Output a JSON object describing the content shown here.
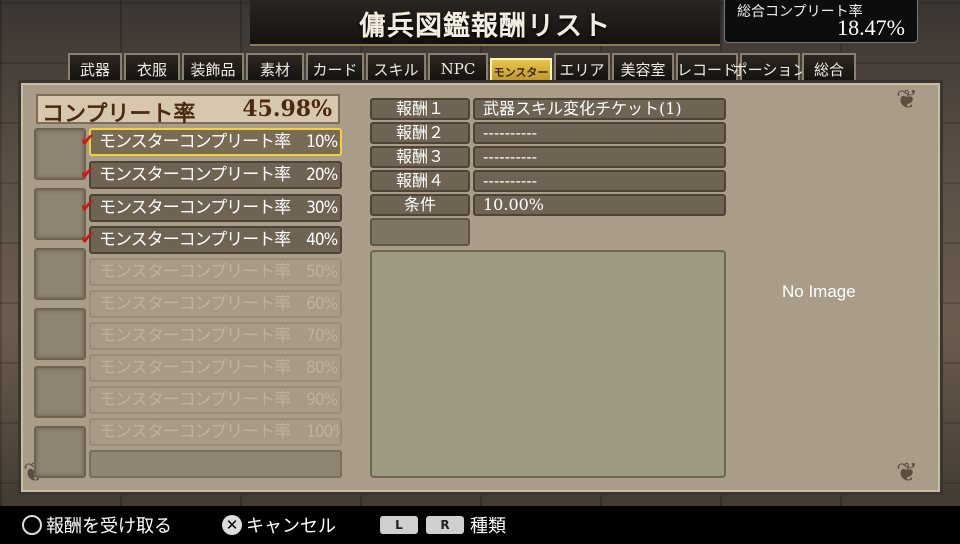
{
  "header": {
    "title": "傭兵図鑑報酬リスト",
    "overall_label": "総合コンプリート率",
    "overall_value": "18.47%"
  },
  "tabs": [
    {
      "label": "武器",
      "active": false
    },
    {
      "label": "衣服",
      "active": false
    },
    {
      "label": "装飾品",
      "active": false
    },
    {
      "label": "素材",
      "active": false
    },
    {
      "label": "カード",
      "active": false
    },
    {
      "label": "スキル",
      "active": false
    },
    {
      "label": "NPC",
      "active": false
    },
    {
      "label": "モンスター",
      "active": true
    },
    {
      "label": "エリア",
      "active": false
    },
    {
      "label": "美容室",
      "active": false
    },
    {
      "label": "レコード",
      "active": false
    },
    {
      "label": "ポーション",
      "active": false
    },
    {
      "label": "総合",
      "active": false
    }
  ],
  "completion": {
    "label": "コンプリート率",
    "value": "45.98%"
  },
  "list": [
    {
      "label": "モンスターコンプリート率　10%",
      "state": "selected",
      "checked": true
    },
    {
      "label": "モンスターコンプリート率　20%",
      "state": "unlocked",
      "checked": true
    },
    {
      "label": "モンスターコンプリート率　30%",
      "state": "unlocked",
      "checked": true
    },
    {
      "label": "モンスターコンプリート率　40%",
      "state": "unlocked",
      "checked": true
    },
    {
      "label": "モンスターコンプリート率　50%",
      "state": "locked",
      "checked": false
    },
    {
      "label": "モンスターコンプリート率　60%",
      "state": "locked",
      "checked": false
    },
    {
      "label": "モンスターコンプリート率　70%",
      "state": "locked",
      "checked": false
    },
    {
      "label": "モンスターコンプリート率　80%",
      "state": "locked",
      "checked": false
    },
    {
      "label": "モンスターコンプリート率　90%",
      "state": "locked",
      "checked": false
    },
    {
      "label": "モンスターコンプリート率　100%",
      "state": "locked",
      "checked": false
    },
    {
      "label": "",
      "state": "empty",
      "checked": false
    }
  ],
  "details": {
    "rows": [
      {
        "label": "報酬１",
        "value": "武器スキル変化チケット(1)"
      },
      {
        "label": "報酬２",
        "value": "----------"
      },
      {
        "label": "報酬３",
        "value": "----------"
      },
      {
        "label": "報酬４",
        "value": "----------"
      },
      {
        "label": "条件",
        "value": "10.00%"
      }
    ],
    "no_image": "No Image"
  },
  "footer": {
    "receive": "報酬を受け取る",
    "cancel": "キャンセル",
    "l_key": "L",
    "r_key": "R",
    "kind": "種類"
  },
  "colors": {
    "accent_gold": "#f2d23a",
    "check_red": "#d01818",
    "panel": "#a99d8a"
  }
}
